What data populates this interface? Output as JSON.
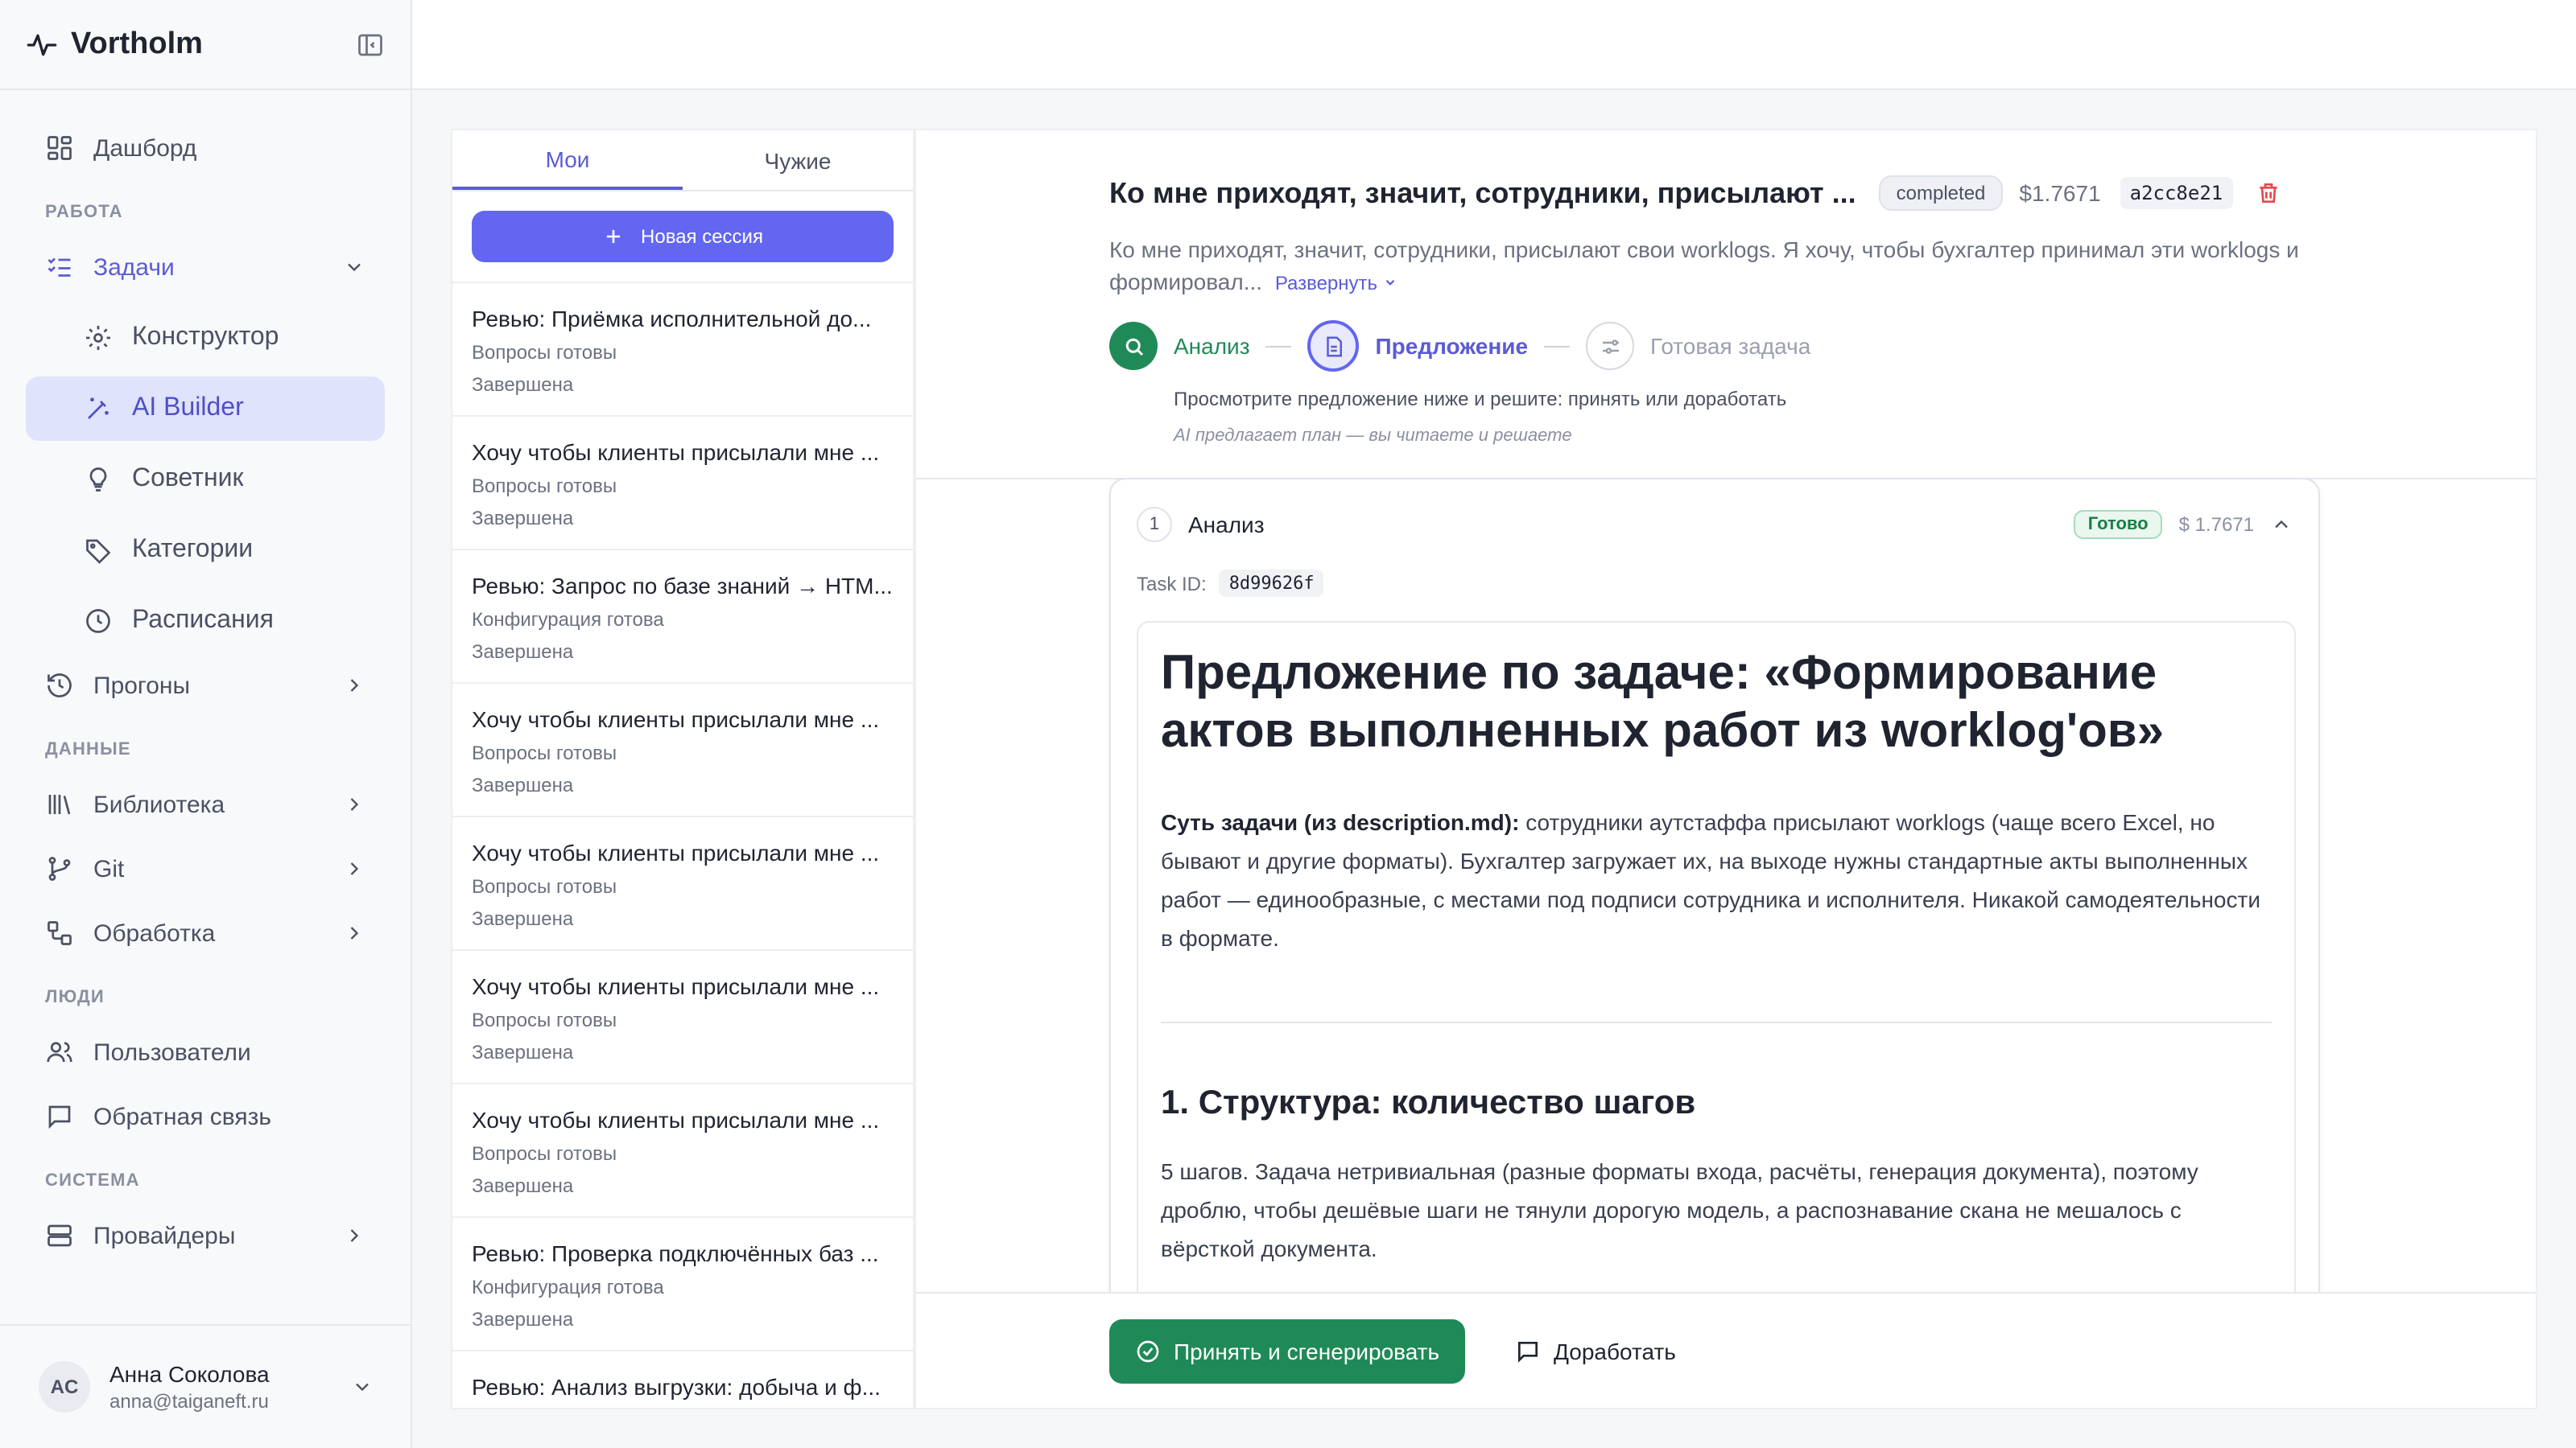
{
  "app": {
    "name": "Vortholm"
  },
  "sidebar": {
    "top_item": "Дашборд",
    "sections": {
      "work": "РАБОТА",
      "data": "ДАННЫЕ",
      "people": "ЛЮДИ",
      "system": "СИСТЕМА"
    },
    "tasks": "Задачи",
    "tasks_sub": [
      "Конструктор",
      "AI Builder",
      "Советник",
      "Категории",
      "Расписания"
    ],
    "runs": "Прогоны",
    "library": "Библиотека",
    "git": "Git",
    "processing": "Обработка",
    "users": "Пользователи",
    "feedback": "Обратная связь",
    "providers": "Провайдеры"
  },
  "user": {
    "initials": "AC",
    "name": "Анна Соколова",
    "email": "anna@taiganeft.ru"
  },
  "sessions": {
    "tabs": [
      "Мои",
      "Чужие"
    ],
    "new_session": "Новая сессия",
    "items": [
      {
        "title": "Ревью: Приёмка исполнительной до...",
        "sub": "Вопросы готовы",
        "status": "Завершена"
      },
      {
        "title": "Хочу чтобы клиенты присылали мне ...",
        "sub": "Вопросы готовы",
        "status": "Завершена"
      },
      {
        "title": "Ревью: Запрос по базе знаний → HTM...",
        "sub": "Конфигурация готова",
        "status": "Завершена"
      },
      {
        "title": "Хочу чтобы клиенты присылали мне ...",
        "sub": "Вопросы готовы",
        "status": "Завершена"
      },
      {
        "title": "Хочу чтобы клиенты присылали мне ...",
        "sub": "Вопросы готовы",
        "status": "Завершена"
      },
      {
        "title": "Хочу чтобы клиенты присылали мне ...",
        "sub": "Вопросы готовы",
        "status": "Завершена"
      },
      {
        "title": "Хочу чтобы клиенты присылали мне ...",
        "sub": "Вопросы готовы",
        "status": "Завершена"
      },
      {
        "title": "Ревью: Проверка подключённых баз ...",
        "sub": "Конфигурация готова",
        "status": "Завершена"
      },
      {
        "title": "Ревью: Анализ выгрузки: добыча и ф...",
        "sub": "",
        "status": ""
      }
    ]
  },
  "task": {
    "title": "Ко мне приходят, значит, сотрудники, присылают ...",
    "status": "completed",
    "cost": "$1.7671",
    "hash": "a2cc8e21",
    "description": "Ко мне приходят, значит, сотрудники, присылают свои worklogs. Я хочу, чтобы бухгалтер принимал эти worklogs и формировал...",
    "expand": "Развернуть",
    "steps": [
      "Анализ",
      "Предложение",
      "Готовая задача"
    ],
    "hint": "Просмотрите предложение ниже и решите: принять или доработать",
    "hint2": "AI предлагает план — вы читаете и решаете"
  },
  "card": {
    "num": "1",
    "title": "Анализ",
    "badge": "Готово",
    "cost": "$ 1.7671",
    "taskid_label": "Task ID:",
    "taskid": "8d99626f",
    "h1": "Предложение по задаче: «Формирование актов выполненных работ из worklog'ов»",
    "p1_bold": "Суть задачи (из description.md):",
    "p1": " сотрудники аутстаффа присылают worklogs (чаще всего Excel, но бывают и другие форматы). Бухгалтер загружает их, на выходе нужны стандартные акты выполненных работ — единообразные, с местами под подписи сотрудника и исполнителя. Никакой самодеятельности в формате.",
    "h2": "1. Структура: количество шагов",
    "p2": "5 шагов. Задача нетривиальная (разные форматы входа, расчёты, генерация документа), поэтому дроблю, чтобы дешёвые шаги не тянули дорогую модель, а распознавание скана не мешалось с вёрсткой документа."
  },
  "footer": {
    "accept": "Принять и сгенерировать",
    "refine": "Доработать"
  },
  "colors": {
    "accent": "#6366f1",
    "success": "#1f8a57",
    "danger": "#e5484d"
  }
}
